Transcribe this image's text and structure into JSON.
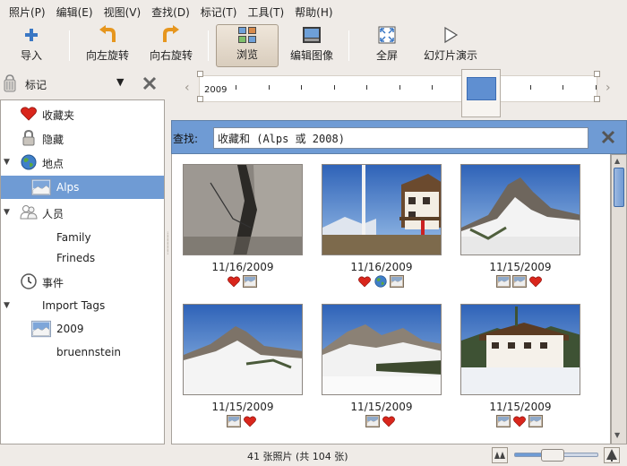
{
  "menu": [
    "照片(P)",
    "编辑(E)",
    "视图(V)",
    "查找(D)",
    "标记(T)",
    "工具(T)",
    "帮助(H)"
  ],
  "toolbar": {
    "import": "导入",
    "rotate_left": "向左旋转",
    "rotate_right": "向右旋转",
    "browse": "浏览",
    "edit_image": "编辑图像",
    "fullscreen": "全屏",
    "slideshow": "幻灯片演示"
  },
  "sidebar": {
    "header_label": "标记",
    "items": [
      {
        "label": "收藏夹",
        "icon": "heart-icon",
        "indent": 0,
        "expander": ""
      },
      {
        "label": "隐藏",
        "icon": "lock-icon",
        "indent": 0,
        "expander": ""
      },
      {
        "label": "地点",
        "icon": "globe-icon",
        "indent": 0,
        "expander": "▼"
      },
      {
        "label": "Alps",
        "icon": "photo-thumb-icon",
        "indent": 1,
        "expander": "",
        "selected": true
      },
      {
        "label": "人员",
        "icon": "people-icon",
        "indent": 0,
        "expander": "▼"
      },
      {
        "label": "Family",
        "icon": "",
        "indent": 1,
        "expander": ""
      },
      {
        "label": "Frineds",
        "icon": "",
        "indent": 1,
        "expander": ""
      },
      {
        "label": "事件",
        "icon": "clock-icon",
        "indent": 0,
        "expander": ""
      },
      {
        "label": "Import Tags",
        "icon": "",
        "indent": 0,
        "expander": "▼"
      },
      {
        "label": "2009",
        "icon": "photo-thumb-icon",
        "indent": 1,
        "expander": ""
      },
      {
        "label": "bruennstein",
        "icon": "",
        "indent": 1,
        "expander": ""
      }
    ]
  },
  "timeline": {
    "year_label": "2009"
  },
  "search": {
    "label": "查找:",
    "query": "收藏和 (Alps 或 2008)"
  },
  "photos": [
    {
      "date": "11/16/2009",
      "icons": [
        "heart-icon",
        "photo-thumb-icon"
      ],
      "scene": "rock"
    },
    {
      "date": "11/16/2009",
      "icons": [
        "heart-icon",
        "globe-icon",
        "photo-thumb-icon"
      ],
      "scene": "chalet"
    },
    {
      "date": "11/15/2009",
      "icons": [
        "photo-thumb-icon",
        "photo-thumb-icon",
        "heart-icon"
      ],
      "scene": "peak"
    },
    {
      "date": "11/15/2009",
      "icons": [
        "photo-thumb-icon",
        "heart-icon"
      ],
      "scene": "snow-mtn"
    },
    {
      "date": "11/15/2009",
      "icons": [
        "photo-thumb-icon",
        "heart-icon"
      ],
      "scene": "ridge"
    },
    {
      "date": "11/15/2009",
      "icons": [
        "photo-thumb-icon",
        "heart-icon",
        "photo-thumb-icon"
      ],
      "scene": "house"
    }
  ],
  "status": {
    "text": "41 张照片 (共 104 张)",
    "zoom": 0.42
  },
  "colors": {
    "selection": "#6f9bd4",
    "heart": "#d9261c"
  }
}
